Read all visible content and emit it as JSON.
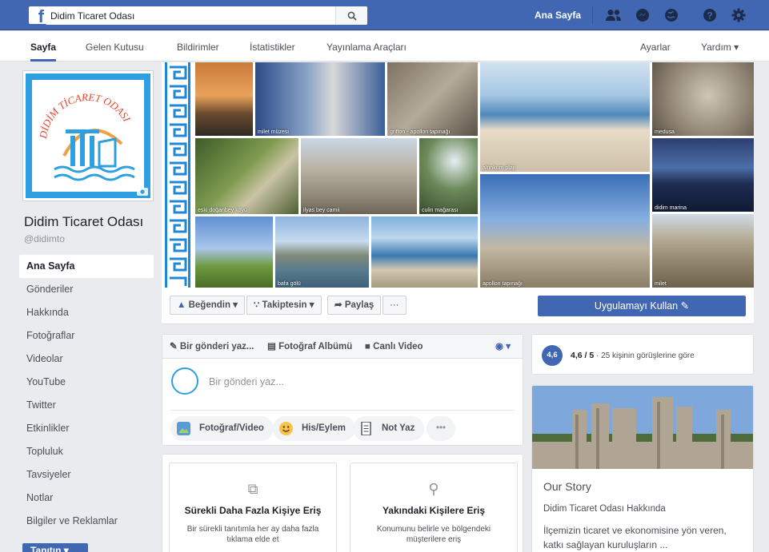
{
  "topbar": {
    "search_value": "Didim Ticaret Odası",
    "home_label": "Ana Sayfa"
  },
  "pagenav": {
    "tabs": [
      "Sayfa",
      "Gelen Kutusu",
      "Bildirimler",
      "İstatistikler",
      "Yayınlama Araçları"
    ],
    "settings": "Ayarlar",
    "help": "Yardım ▾"
  },
  "profile": {
    "logo_text": "DİDİM TİCARET ODASI",
    "name": "Didim Ticaret Odası",
    "handle": "@didimto"
  },
  "leftnav": {
    "items": [
      "Ana Sayfa",
      "Gönderiler",
      "Hakkında",
      "Fotoğraflar",
      "Videolar",
      "YouTube",
      "Twitter",
      "Etkinlikler",
      "Topluluk",
      "Tavsiyeler",
      "Notlar",
      "Bilgiler ve Reklamlar"
    ],
    "promote": "Tanıtın ▾"
  },
  "cover": {
    "captions": [
      "milet müzesi",
      "griffon - apollon tapınağı",
      "altınkum plajı",
      "medusa",
      "eski doğanbey köyü",
      "ilyas bey camii",
      "culin mağarası",
      "didim marina",
      "bafa gölü",
      "apollon tapınağı",
      "milet"
    ]
  },
  "actions": {
    "like": "Beğendin ▾",
    "follow": "Takiptesin ▾",
    "share": "Paylaş",
    "more": "···",
    "use_app": "Uygulamayı Kullan ✎"
  },
  "composer": {
    "tab_write": "Bir gönderi yaz...",
    "tab_album": "Fotoğraf Albümü",
    "tab_live": "Canlı Video",
    "placeholder": "Bir gönderi yaz...",
    "chip_photo": "Fotoğraf/Video",
    "chip_feeling": "His/Eylem",
    "chip_note": "Not Yaz",
    "chip_more": "•••"
  },
  "promos": [
    {
      "title": "Sürekli Daha Fazla Kişiye Eriş",
      "desc": "Bir sürekli tanıtımla her ay daha fazla tıklama elde et"
    },
    {
      "title": "Yakındaki Kişilere Eriş",
      "desc": "Konumunu belirle ve bölgendeki müşterilere eriş"
    }
  ],
  "rating": {
    "badge": "4,6",
    "score": "4,6 / 5",
    "detail": " · 25 kişinin görüşlerine göre"
  },
  "story": {
    "heading": "Our Story",
    "subheading": "Didim Ticaret Odası Hakkında",
    "body": "İlçemizin ticaret ve ekonomisine yön veren, katkı sağlayan kuruluşların ..."
  }
}
